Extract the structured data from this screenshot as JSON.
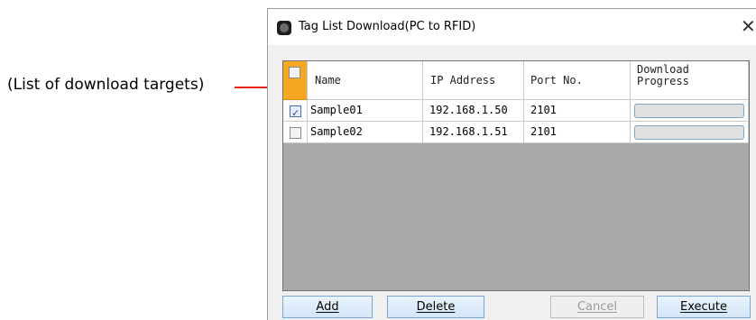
{
  "annotation": {
    "text": "(List of download targets)"
  },
  "window": {
    "title": "Tag List Download(PC to RFID)",
    "close_icon": "close-icon"
  },
  "grid": {
    "columns": [
      "Name",
      "IP Address",
      "Port No.",
      "Download Progress"
    ],
    "rows": [
      {
        "checked": true,
        "name": "Sample01",
        "ip": "192.168.1.50",
        "port": "2101",
        "progress": 0
      },
      {
        "checked": false,
        "name": "Sample02",
        "ip": "192.168.1.51",
        "port": "2101",
        "progress": 0
      }
    ]
  },
  "buttons": {
    "add": "Add",
    "delete": "Delete",
    "cancel": "Cancel",
    "execute": "Execute"
  },
  "colors": {
    "header_select": "#f7a823",
    "grid_background": "#a9a9a9",
    "leader": "#e8231b"
  }
}
